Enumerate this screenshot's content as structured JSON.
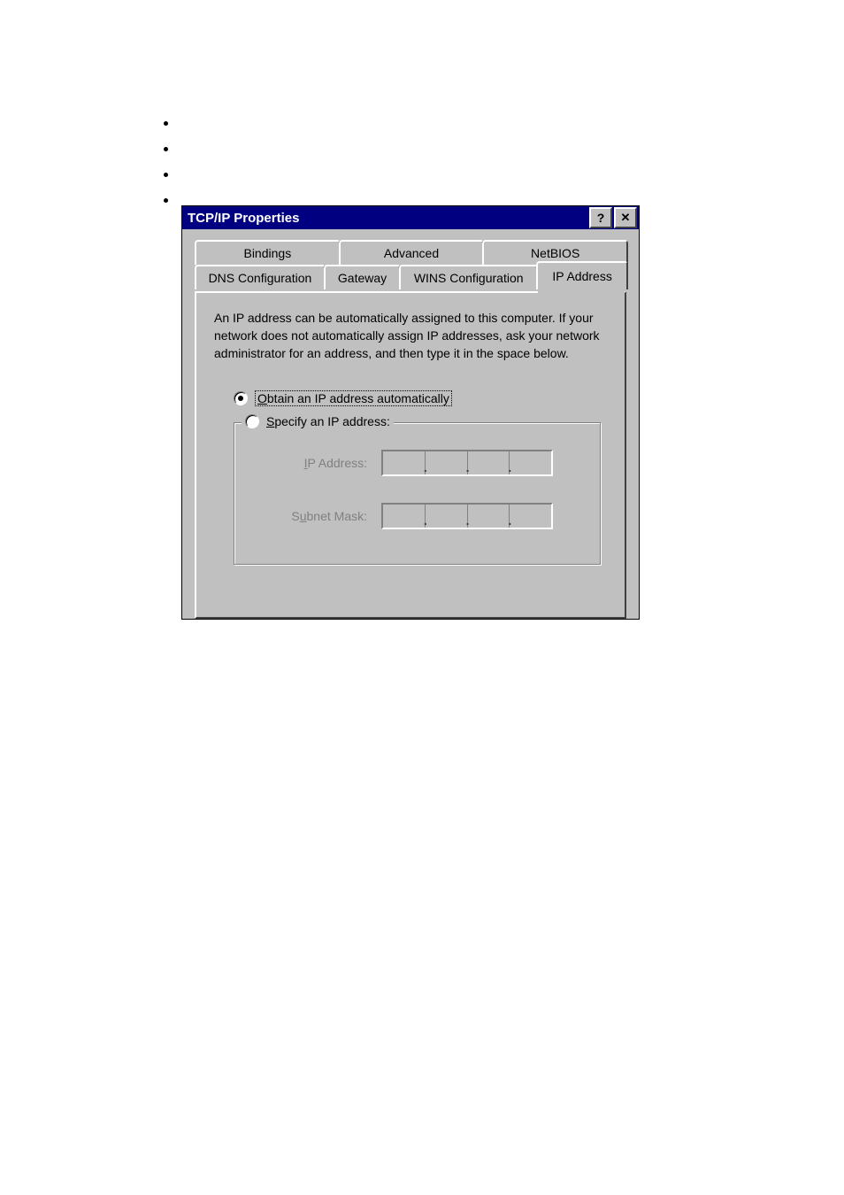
{
  "bullets": [
    "",
    "",
    "",
    ""
  ],
  "dialog": {
    "title": "TCP/IP Properties",
    "help_glyph": "?",
    "close_glyph": "✕",
    "tabs_top": [
      {
        "label": "Bindings"
      },
      {
        "label": "Advanced"
      },
      {
        "label": "NetBIOS"
      }
    ],
    "tabs_bottom": [
      {
        "label": "DNS Configuration"
      },
      {
        "label": "Gateway"
      },
      {
        "label": "WINS Configuration"
      },
      {
        "label": "IP Address",
        "active": true
      }
    ],
    "description": "An IP address can be automatically assigned to this computer. If your network does not automatically assign IP addresses, ask your network administrator for an address, and then type it in the space below.",
    "radio_obtain": {
      "pre": "",
      "accel": "O",
      "post": "btain an IP address automatically",
      "selected": true
    },
    "radio_specify": {
      "pre": "",
      "accel": "S",
      "post": "pecify an IP address:",
      "selected": false
    },
    "fields": {
      "ip": {
        "pre": "",
        "accel": "I",
        "post": "P Address:"
      },
      "mask": {
        "pre": "S",
        "accel": "u",
        "post": "bnet Mask:"
      }
    }
  }
}
